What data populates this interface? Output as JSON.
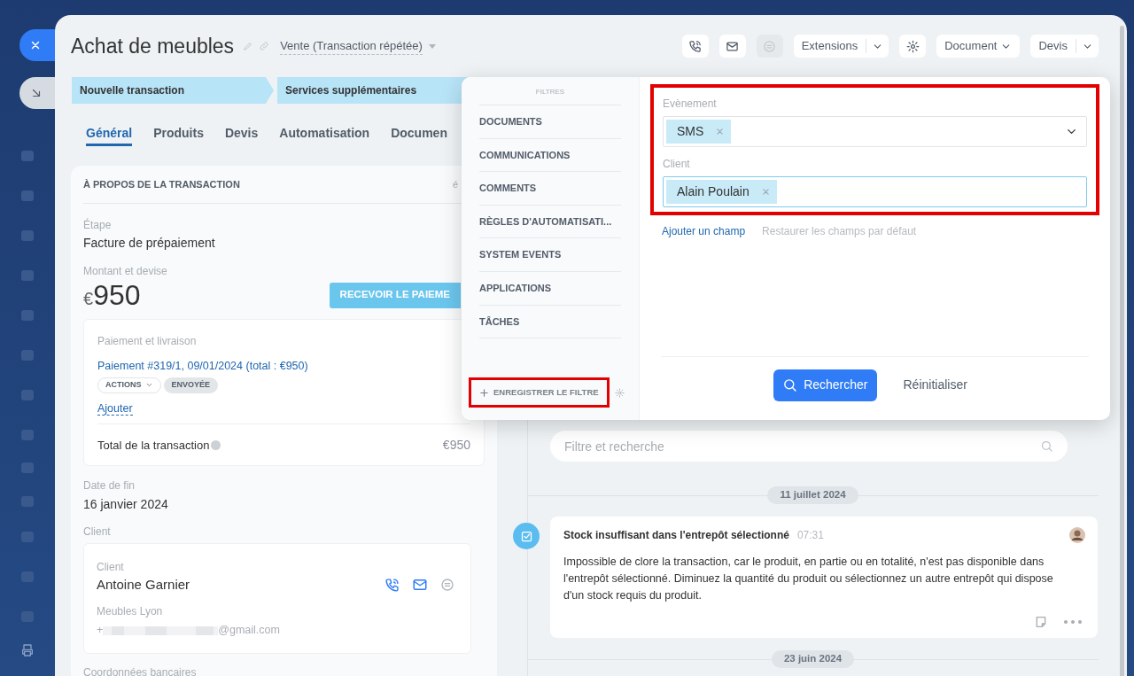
{
  "header": {
    "title": "Achat de meubles",
    "deal_type": "Vente (Transaction répétée)"
  },
  "toolbar": [
    {
      "kind": "phone",
      "disabled": false
    },
    {
      "kind": "mail",
      "disabled": false
    },
    {
      "kind": "chat",
      "disabled": true
    },
    {
      "kind": "split",
      "label": "Extensions"
    },
    {
      "kind": "gear",
      "disabled": false
    },
    {
      "kind": "dropdown",
      "label": "Document"
    },
    {
      "kind": "split",
      "label": "Devis"
    }
  ],
  "stages": [
    {
      "label": "Nouvelle transaction"
    },
    {
      "label": "Services supplémentaires"
    }
  ],
  "tabs": [
    {
      "label": "Général",
      "selected": true
    },
    {
      "label": "Produits",
      "selected": false
    },
    {
      "label": "Devis",
      "selected": false
    },
    {
      "label": "Automatisation",
      "selected": false
    },
    {
      "label": "Documen",
      "selected": false
    }
  ],
  "deal": {
    "section_title": "À PROPOS DE LA TRANSACTION",
    "section_action": "é",
    "stage_label": "Étape",
    "stage_value": "Facture de prépaiement",
    "amount_label": "Montant et devise",
    "currency": "€",
    "amount": "950",
    "pay_button": "RECEVOIR LE PAIEME",
    "payment": {
      "title": "Paiement et livraison",
      "link": "Paiement #319/1, 09/01/2024 (total : €950)",
      "actions": "ACTIONS",
      "status": "ENVOYÉE",
      "add": "Ajouter",
      "total_label": "Total de la transaction",
      "total_value": "€950"
    },
    "end_date_label": "Date de fin",
    "end_date": "16 janvier 2024",
    "client_section": "Client",
    "client": {
      "label": "Client",
      "name": "Antoine Garnier",
      "company": "Meubles Lyon",
      "phone_prefix": "+",
      "email_suffix": "@gmail.com"
    },
    "bank_label": "Coordonnées bancaires"
  },
  "timeline": {
    "search_placeholder": "Filtre et recherche",
    "groups": [
      {
        "date": "11 juillet 2024",
        "items": [
          {
            "title": "Stock insuffisant dans l'entrepôt sélectionné",
            "time": "07:31",
            "text": "Impossible de clore la transaction, car le produit, en partie ou en totalité, n'est pas disponible dans l'entrepôt sélectionné. Diminuez la quantité du produit ou sélectionnez un autre entrepôt qui dispose d'un stock requis du produit."
          }
        ]
      },
      {
        "date": "23 juin 2024"
      }
    ]
  },
  "filter_popup": {
    "heading": "FILTRES",
    "presets": [
      {
        "label": "DOCUMENTS"
      },
      {
        "label": "COMMUNICATIONS"
      },
      {
        "label": "COMMENTS"
      },
      {
        "label": "RÈGLES D'AUTOMATISATI..."
      },
      {
        "label": "SYSTEM EVENTS"
      },
      {
        "label": "APPLICATIONS"
      },
      {
        "label": "TÂCHES"
      }
    ],
    "save_filter": {
      "label": "ENREGISTRER LE FILTRE",
      "highlighted": true
    },
    "fields_highlighted": true,
    "fields": [
      {
        "label": "Evènement",
        "kind": "select",
        "tags": [
          "SMS"
        ],
        "focused": false
      },
      {
        "label": "Client",
        "kind": "entity",
        "tags": [
          "Alain Poulain"
        ],
        "focused": true
      }
    ],
    "add_field": "Ajouter un champ",
    "restore_fields": "Restaurer les champs par défaut",
    "search_button": "Rechercher",
    "reset_button": "Réinitialiser"
  }
}
